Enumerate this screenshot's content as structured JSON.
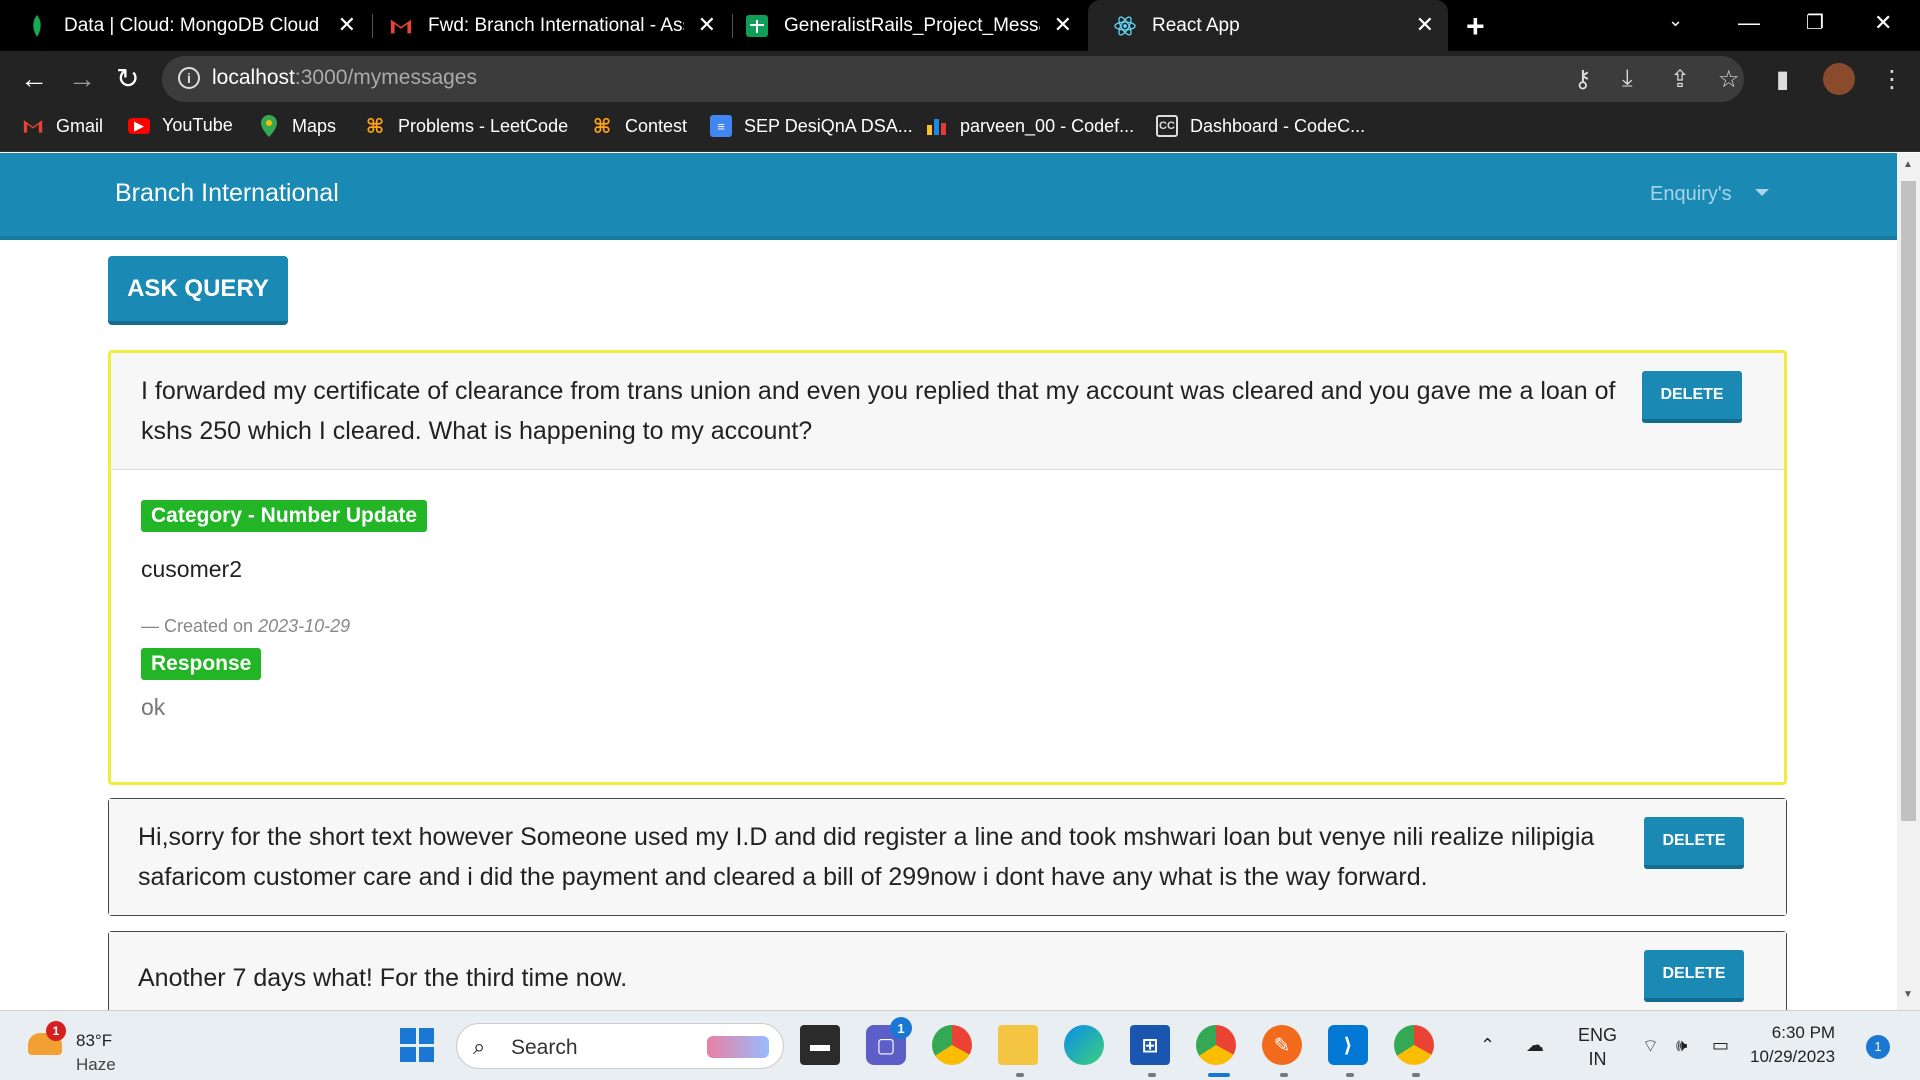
{
  "browser": {
    "tabs": [
      {
        "title": "Data | Cloud: MongoDB Cloud",
        "icon": "mongodb-leaf-icon",
        "color": "#13aa52"
      },
      {
        "title": "Fwd: Branch International - Assig",
        "icon": "gmail-icon",
        "color": "#ea4335"
      },
      {
        "title": "GeneralistRails_Project_Message",
        "icon": "sheets-icon",
        "color": "#0f9d58"
      },
      {
        "title": "React App",
        "icon": "react-icon",
        "color": "#61dafb"
      }
    ],
    "new_tab": "+",
    "url_host": "localhost",
    "url_path": ":3000/mymessages",
    "bookmarks": [
      {
        "label": "Gmail",
        "icon": "gmail-icon"
      },
      {
        "label": "YouTube",
        "icon": "youtube-icon"
      },
      {
        "label": "Maps",
        "icon": "maps-icon"
      },
      {
        "label": "Problems - LeetCode",
        "icon": "leetcode-icon"
      },
      {
        "label": "Contest",
        "icon": "leetcode-icon"
      },
      {
        "label": "SEP DesiQnA DSA...",
        "icon": "docs-icon"
      },
      {
        "label": "parveen_00 - Codef...",
        "icon": "codeforces-icon"
      },
      {
        "label": "Dashboard - CodeC...",
        "icon": "codechef-icon"
      }
    ]
  },
  "app": {
    "brand": "Branch International",
    "menu": "Enquiry's",
    "ask_button": "ASK QUERY",
    "messages": [
      {
        "text": "I forwarded my certificate of clearance from trans union and even you replied that my account was cleared and you gave me a loan of kshs 250 which I cleared. What is happening to my account?",
        "delete": "DELETE",
        "category": "Category - Number Update",
        "customer": "cusomer2",
        "created_prefix": "— Created on",
        "created_date": "2023-10-29",
        "response_label": "Response",
        "response": "ok"
      },
      {
        "text": "Hi,sorry for the short text however Someone used my I.D and did register a line and took mshwari loan but venye nili realize nilipigia safaricom customer care and i did the payment and cleared a bill of 299now i dont have any what is the way forward.",
        "delete": "DELETE"
      },
      {
        "text": "Another 7 days what! For the third time now.",
        "delete": "DELETE"
      }
    ]
  },
  "taskbar": {
    "weather_temp": "83°F",
    "weather_cond": "Haze",
    "weather_badge": "1",
    "search": "Search",
    "teams_badge": "1",
    "lang1": "ENG",
    "lang2": "IN",
    "time": "6:30 PM",
    "date": "10/29/2023",
    "notifications": "1"
  },
  "colors": {
    "accent": "#1a8ab5",
    "highlight_border": "#f2ec3c",
    "badge_green": "#22b525"
  }
}
